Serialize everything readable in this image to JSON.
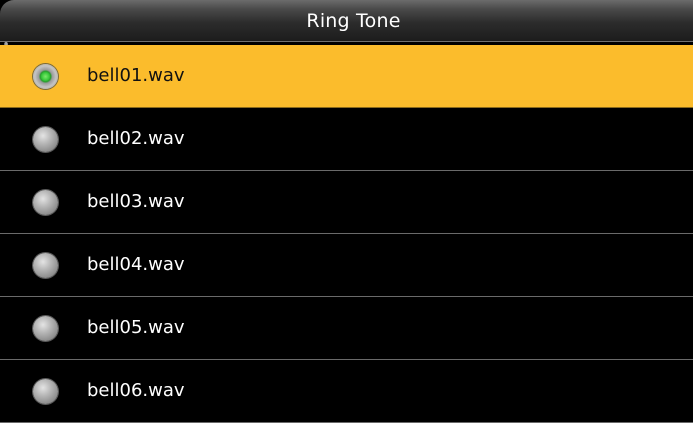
{
  "header": {
    "title": "Ring Tone"
  },
  "list": {
    "items": [
      {
        "label": "bell01.wav",
        "selected": true
      },
      {
        "label": "bell02.wav",
        "selected": false
      },
      {
        "label": "bell03.wav",
        "selected": false
      },
      {
        "label": "bell04.wav",
        "selected": false
      },
      {
        "label": "bell05.wav",
        "selected": false
      },
      {
        "label": "bell06.wav",
        "selected": false
      }
    ]
  },
  "colors": {
    "selected_background": "#fbbc2c",
    "background": "#000000",
    "radio_selected": "#37c93a",
    "radio_unselected": "#b8b8b8"
  }
}
